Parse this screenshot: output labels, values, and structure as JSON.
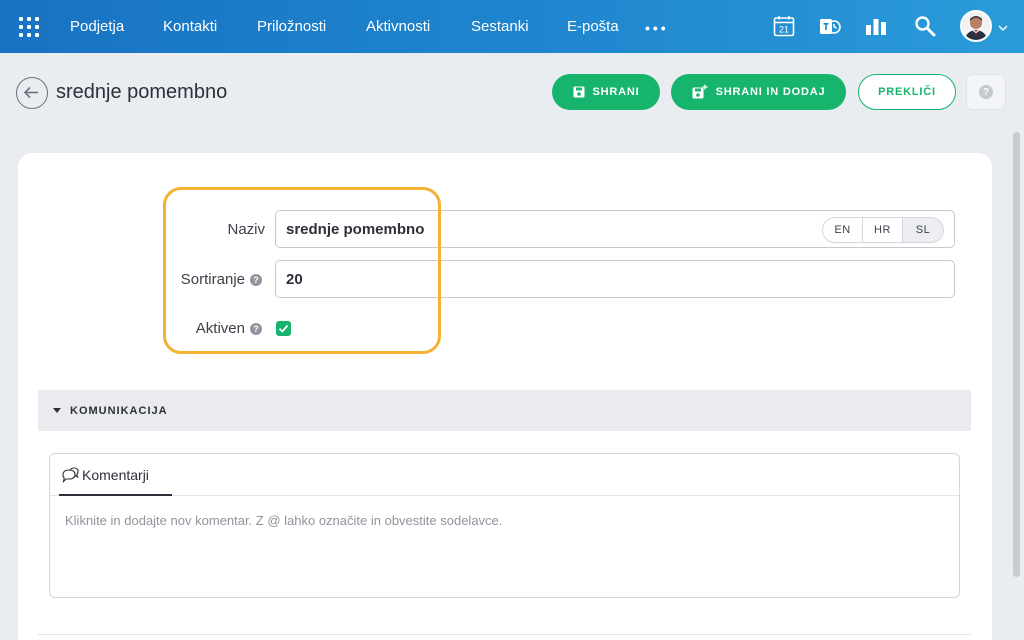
{
  "nav": {
    "items": [
      "Podjetja",
      "Kontakti",
      "Priložnosti",
      "Aktivnosti",
      "Sestanki",
      "E-pošta"
    ],
    "more": "•••",
    "calendar_day": "21",
    "icons": [
      "apps-grid-icon",
      "calendar-icon",
      "teams-icon",
      "analytics-icon",
      "search-icon",
      "avatar",
      "chevron-down-icon"
    ]
  },
  "header": {
    "title": "srednje pomembno",
    "save_label": "SHRANI",
    "save_add_label": "SHRANI IN DODAJ",
    "cancel_label": "PREKLIČI",
    "help_label": "?"
  },
  "form": {
    "name_label": "Naziv",
    "name_value": "srednje pomembno",
    "languages": [
      "EN",
      "HR",
      "SL"
    ],
    "active_language": "SL",
    "sort_label": "Sortiranje",
    "sort_value": "20",
    "active_label": "Aktiven",
    "active_checked": true,
    "help_glyph": "?"
  },
  "section": {
    "title": "KOMUNIKACIJA"
  },
  "comments": {
    "tab_label": "Komentarji",
    "placeholder": "Kliknite in dodajte nov komentar. Z @ lahko označite in obvestite sodelavce."
  },
  "colors": {
    "nav_start": "#1873c2",
    "nav_end": "#2a9bd9",
    "accent_green": "#16b46c",
    "highlight_orange": "#f4b132"
  }
}
